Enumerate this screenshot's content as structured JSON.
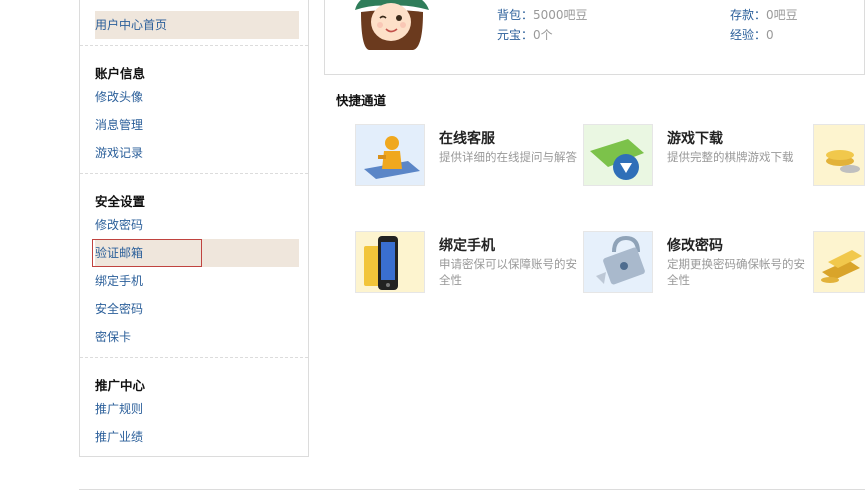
{
  "sidebar": {
    "home": "用户中心首页",
    "sections": [
      {
        "title": "账户信息",
        "items": [
          "修改头像",
          "消息管理",
          "游戏记录"
        ]
      },
      {
        "title": "安全设置",
        "items": [
          "修改密码",
          "验证邮箱",
          "绑定手机",
          "安全密码",
          "密保卡"
        ]
      },
      {
        "title": "推广中心",
        "items": [
          "推广规则",
          "推广业绩"
        ]
      }
    ]
  },
  "profile": {
    "backpack_label": "背包：",
    "backpack_value": "5000吧豆",
    "yuanbao_label": "元宝：",
    "yuanbao_value": "0个",
    "deposit_label": "存款：",
    "deposit_value": "0吧豆",
    "exp_label": "经验：",
    "exp_value": "0"
  },
  "quick": {
    "title": "快捷通道",
    "tiles": [
      {
        "title": "在线客服",
        "desc": "提供详细的在线提问与解答",
        "icon": "customer-service-icon"
      },
      {
        "title": "游戏下载",
        "desc": "提供完整的棋牌游戏下载",
        "icon": "download-icon"
      },
      {
        "title": "绑定手机",
        "desc": "申请密保可以保障账号的安全性",
        "icon": "mobile-phone-icon"
      },
      {
        "title": "修改密码",
        "desc": "定期更换密码确保帐号的安全性",
        "icon": "padlock-icon"
      }
    ]
  },
  "colors": {
    "link": "#2b5f9a",
    "active_bg": "#efe6dc",
    "highlight_border": "#c0433f"
  }
}
